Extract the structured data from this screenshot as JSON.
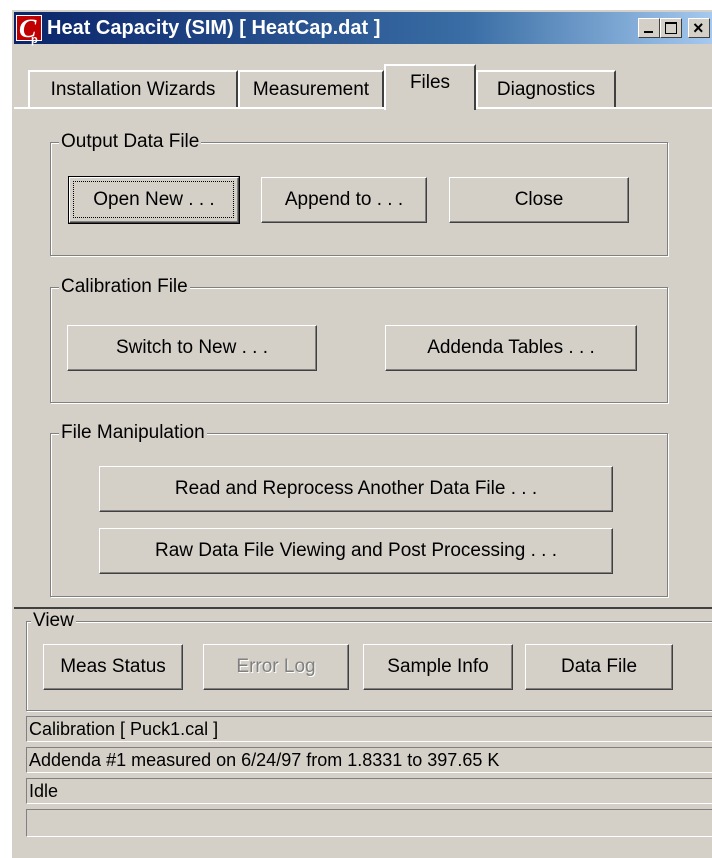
{
  "window": {
    "title": "Heat Capacity (SIM)   [ HeatCap.dat ]",
    "icon": "cp-app-icon",
    "icon_letters": {
      "main": "C",
      "sub": "p"
    }
  },
  "tabs": [
    {
      "label": "Installation Wizards",
      "active": false
    },
    {
      "label": "Measurement",
      "active": false
    },
    {
      "label": "Files",
      "active": true
    },
    {
      "label": "Diagnostics",
      "active": false
    }
  ],
  "output_data_file": {
    "label": "Output Data File",
    "open_new": "Open New . . .",
    "append_to": "Append to . . .",
    "close": "Close"
  },
  "calibration_file": {
    "label": "Calibration File",
    "switch_to_new": "Switch to New . . .",
    "addenda_tables": "Addenda Tables . . ."
  },
  "file_manipulation": {
    "label": "File Manipulation",
    "read_reprocess": "Read and Reprocess Another Data File . . .",
    "raw_data_viewing": "Raw Data File Viewing and Post Processing . . ."
  },
  "view": {
    "label": "View",
    "meas_status": "Meas Status",
    "error_log": "Error Log",
    "sample_info": "Sample Info",
    "data_file": "Data File"
  },
  "status_lines": [
    "Calibration [ Puck1.cal ]",
    "Addenda #1 measured on 6/24/97 from 1.8331 to 397.65 K",
    "Idle",
    ""
  ]
}
